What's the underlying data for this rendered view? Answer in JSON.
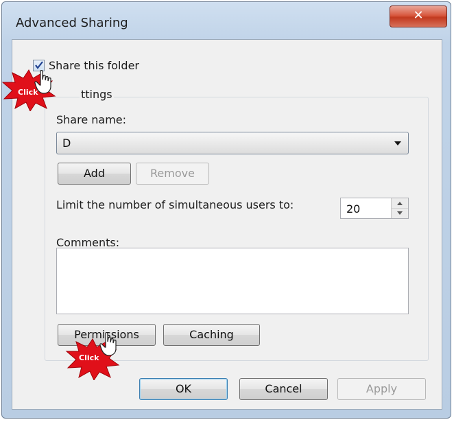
{
  "window": {
    "title": "Advanced Sharing",
    "close_glyph": "✕"
  },
  "share_checkbox": {
    "label": "Share this folder",
    "checked": true
  },
  "settings": {
    "group_title": "ttings",
    "share_name_label": "Share name:",
    "share_name_value": "D",
    "add_label": "Add",
    "remove_label": "Remove",
    "limit_label": "Limit the number of simultaneous users to:",
    "limit_value": "20",
    "comments_label": "Comments:",
    "comments_value": "",
    "permissions_label": "Permissions",
    "caching_label": "Caching"
  },
  "footer": {
    "ok_label": "OK",
    "cancel_label": "Cancel",
    "apply_label": "Apply"
  },
  "annotations": {
    "click_label_1": "Click",
    "click_label_2": "Click"
  },
  "colors": {
    "burst": "#e0101a",
    "close_button": "#c94a30",
    "title_bg": "#c8dbef"
  },
  "icons": [
    "checkmark-icon",
    "hand-cursor-icon",
    "dropdown-arrow-icon",
    "spin-up-icon",
    "spin-down-icon",
    "close-icon"
  ]
}
